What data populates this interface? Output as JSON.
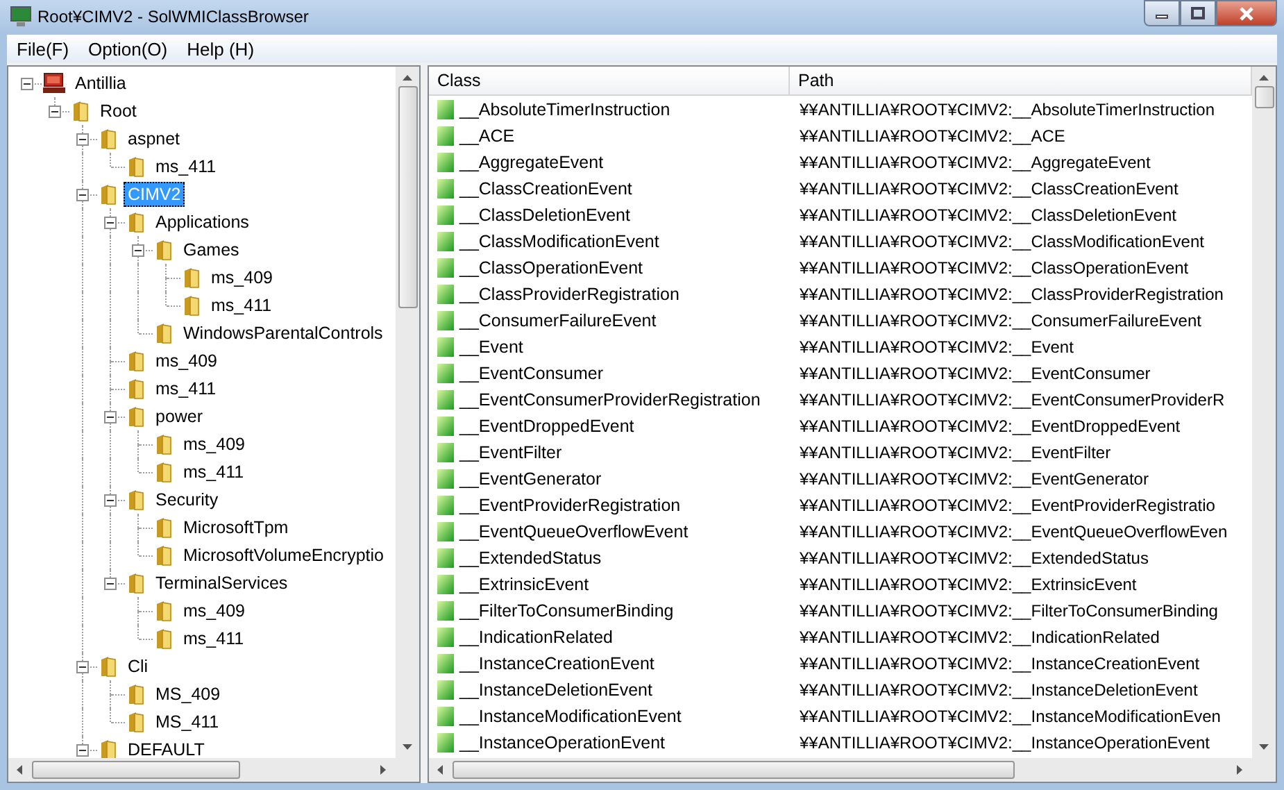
{
  "window": {
    "title": "Root¥CIMV2 - SolWMIClassBrowser"
  },
  "menu": [
    "File(F)",
    "Option(O)",
    "Help (H)"
  ],
  "tree": [
    {
      "label": "Antillia",
      "kind": "computer",
      "expanded": true,
      "selected": false,
      "children": [
        {
          "label": "Root",
          "kind": "folder",
          "expanded": true,
          "selected": false,
          "children": [
            {
              "label": "aspnet",
              "kind": "folder",
              "expanded": true,
              "selected": false,
              "children": [
                {
                  "label": "ms_411",
                  "kind": "folder",
                  "selected": false
                }
              ]
            },
            {
              "label": "CIMV2",
              "kind": "folder",
              "expanded": true,
              "selected": true,
              "children": [
                {
                  "label": "Applications",
                  "kind": "folder",
                  "expanded": true,
                  "selected": false,
                  "children": [
                    {
                      "label": "Games",
                      "kind": "folder",
                      "expanded": true,
                      "selected": false,
                      "children": [
                        {
                          "label": "ms_409",
                          "kind": "folder",
                          "selected": false
                        },
                        {
                          "label": "ms_411",
                          "kind": "folder",
                          "selected": false
                        }
                      ]
                    },
                    {
                      "label": "WindowsParentalControls",
                      "kind": "folder",
                      "selected": false
                    }
                  ]
                },
                {
                  "label": "ms_409",
                  "kind": "folder",
                  "selected": false
                },
                {
                  "label": "ms_411",
                  "kind": "folder",
                  "selected": false
                },
                {
                  "label": "power",
                  "kind": "folder",
                  "expanded": true,
                  "selected": false,
                  "children": [
                    {
                      "label": "ms_409",
                      "kind": "folder",
                      "selected": false
                    },
                    {
                      "label": "ms_411",
                      "kind": "folder",
                      "selected": false
                    }
                  ]
                },
                {
                  "label": "Security",
                  "kind": "folder",
                  "expanded": true,
                  "selected": false,
                  "children": [
                    {
                      "label": "MicrosoftTpm",
                      "kind": "folder",
                      "selected": false
                    },
                    {
                      "label": "MicrosoftVolumeEncryptio",
                      "kind": "folder",
                      "selected": false
                    }
                  ]
                },
                {
                  "label": "TerminalServices",
                  "kind": "folder",
                  "expanded": true,
                  "selected": false,
                  "children": [
                    {
                      "label": "ms_409",
                      "kind": "folder",
                      "selected": false
                    },
                    {
                      "label": "ms_411",
                      "kind": "folder",
                      "selected": false
                    }
                  ]
                }
              ]
            },
            {
              "label": "Cli",
              "kind": "folder",
              "expanded": true,
              "selected": false,
              "children": [
                {
                  "label": "MS_409",
                  "kind": "folder",
                  "selected": false
                },
                {
                  "label": "MS_411",
                  "kind": "folder",
                  "selected": false
                }
              ]
            },
            {
              "label": "DEFAULT",
              "kind": "folder",
              "expanded": true,
              "selected": false
            }
          ]
        }
      ]
    }
  ],
  "table": {
    "columns": [
      "Class",
      "Path"
    ],
    "rows": [
      {
        "class": "__AbsoluteTimerInstruction",
        "path": "¥¥ANTILLIA¥ROOT¥CIMV2:__AbsoluteTimerInstruction"
      },
      {
        "class": "__ACE",
        "path": "¥¥ANTILLIA¥ROOT¥CIMV2:__ACE"
      },
      {
        "class": "__AggregateEvent",
        "path": "¥¥ANTILLIA¥ROOT¥CIMV2:__AggregateEvent"
      },
      {
        "class": "__ClassCreationEvent",
        "path": "¥¥ANTILLIA¥ROOT¥CIMV2:__ClassCreationEvent"
      },
      {
        "class": "__ClassDeletionEvent",
        "path": "¥¥ANTILLIA¥ROOT¥CIMV2:__ClassDeletionEvent"
      },
      {
        "class": "__ClassModificationEvent",
        "path": "¥¥ANTILLIA¥ROOT¥CIMV2:__ClassModificationEvent"
      },
      {
        "class": "__ClassOperationEvent",
        "path": "¥¥ANTILLIA¥ROOT¥CIMV2:__ClassOperationEvent"
      },
      {
        "class": "__ClassProviderRegistration",
        "path": "¥¥ANTILLIA¥ROOT¥CIMV2:__ClassProviderRegistration"
      },
      {
        "class": "__ConsumerFailureEvent",
        "path": "¥¥ANTILLIA¥ROOT¥CIMV2:__ConsumerFailureEvent"
      },
      {
        "class": "__Event",
        "path": "¥¥ANTILLIA¥ROOT¥CIMV2:__Event"
      },
      {
        "class": "__EventConsumer",
        "path": "¥¥ANTILLIA¥ROOT¥CIMV2:__EventConsumer"
      },
      {
        "class": "__EventConsumerProviderRegistration",
        "path": "¥¥ANTILLIA¥ROOT¥CIMV2:__EventConsumerProviderR"
      },
      {
        "class": "__EventDroppedEvent",
        "path": "¥¥ANTILLIA¥ROOT¥CIMV2:__EventDroppedEvent"
      },
      {
        "class": "__EventFilter",
        "path": "¥¥ANTILLIA¥ROOT¥CIMV2:__EventFilter"
      },
      {
        "class": "__EventGenerator",
        "path": "¥¥ANTILLIA¥ROOT¥CIMV2:__EventGenerator"
      },
      {
        "class": "__EventProviderRegistration",
        "path": "¥¥ANTILLIA¥ROOT¥CIMV2:__EventProviderRegistratio"
      },
      {
        "class": "__EventQueueOverflowEvent",
        "path": "¥¥ANTILLIA¥ROOT¥CIMV2:__EventQueueOverflowEven"
      },
      {
        "class": "__ExtendedStatus",
        "path": "¥¥ANTILLIA¥ROOT¥CIMV2:__ExtendedStatus"
      },
      {
        "class": "__ExtrinsicEvent",
        "path": "¥¥ANTILLIA¥ROOT¥CIMV2:__ExtrinsicEvent"
      },
      {
        "class": "__FilterToConsumerBinding",
        "path": "¥¥ANTILLIA¥ROOT¥CIMV2:__FilterToConsumerBinding"
      },
      {
        "class": "__IndicationRelated",
        "path": "¥¥ANTILLIA¥ROOT¥CIMV2:__IndicationRelated"
      },
      {
        "class": "__InstanceCreationEvent",
        "path": "¥¥ANTILLIA¥ROOT¥CIMV2:__InstanceCreationEvent"
      },
      {
        "class": "__InstanceDeletionEvent",
        "path": "¥¥ANTILLIA¥ROOT¥CIMV2:__InstanceDeletionEvent"
      },
      {
        "class": "__InstanceModificationEvent",
        "path": "¥¥ANTILLIA¥ROOT¥CIMV2:__InstanceModificationEven"
      },
      {
        "class": "__InstanceOperationEvent",
        "path": "¥¥ANTILLIA¥ROOT¥CIMV2:__InstanceOperationEvent"
      }
    ]
  }
}
